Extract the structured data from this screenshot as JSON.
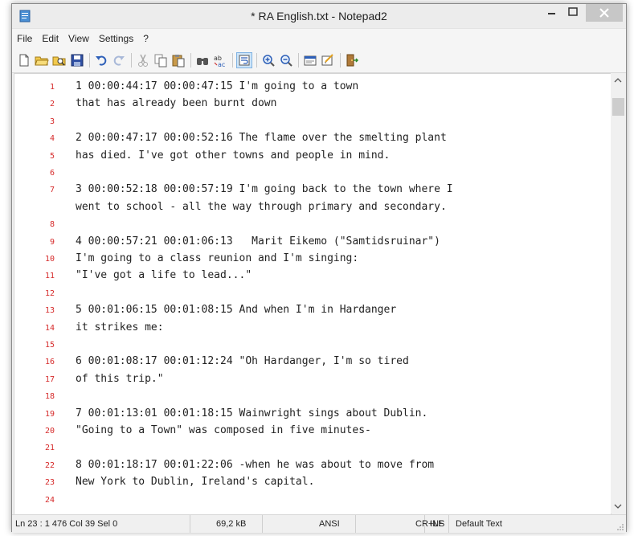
{
  "window": {
    "title": "* RA English.txt - Notepad2"
  },
  "menu": [
    "File",
    "Edit",
    "View",
    "Settings",
    "?"
  ],
  "toolbar": {
    "icons": [
      "new-file-icon",
      "open-folder-icon",
      "browse-icon",
      "save-icon",
      "undo-icon",
      "redo-icon",
      "cut-icon",
      "copy-icon",
      "paste-icon",
      "find-icon",
      "replace-icon",
      "word-wrap-icon",
      "zoom-in-icon",
      "zoom-out-icon",
      "scheme-icon",
      "customize-icon",
      "exit-icon"
    ]
  },
  "editor": {
    "lines": [
      {
        "n": "1",
        "text": "1 00:00:44:17 00:00:47:15 I'm going to a town"
      },
      {
        "n": "2",
        "text": "that has already been burnt down"
      },
      {
        "n": "3",
        "text": ""
      },
      {
        "n": "4",
        "text": "2 00:00:47:17 00:00:52:16 The flame over the smelting plant"
      },
      {
        "n": "5",
        "text": "has died. I've got other towns and people in mind."
      },
      {
        "n": "6",
        "text": ""
      },
      {
        "n": "7",
        "text": "3 00:00:52:18 00:00:57:19 I'm going back to the town where I"
      },
      {
        "n": "",
        "text": "went to school - all the way through primary and secondary."
      },
      {
        "n": "8",
        "text": ""
      },
      {
        "n": "9",
        "text": "4 00:00:57:21 00:01:06:13   Marit Eikemo (\"Samtidsruinar\")"
      },
      {
        "n": "10",
        "text": "I'm going to a class reunion and I'm singing:"
      },
      {
        "n": "11",
        "text": "\"I've got a life to lead...\""
      },
      {
        "n": "12",
        "text": ""
      },
      {
        "n": "13",
        "text": "5 00:01:06:15 00:01:08:15 And when I'm in Hardanger"
      },
      {
        "n": "14",
        "text": "it strikes me:"
      },
      {
        "n": "15",
        "text": ""
      },
      {
        "n": "16",
        "text": "6 00:01:08:17 00:01:12:24 \"Oh Hardanger, I'm so tired"
      },
      {
        "n": "17",
        "text": "of this trip.\""
      },
      {
        "n": "18",
        "text": ""
      },
      {
        "n": "19",
        "text": "7 00:01:13:01 00:01:18:15 Wainwright sings about Dublin."
      },
      {
        "n": "20",
        "text": "\"Going to a Town\" was composed in five minutes-"
      },
      {
        "n": "21",
        "text": ""
      },
      {
        "n": "22",
        "text": "8 00:01:18:17 00:01:22:06 -when he was about to move from"
      },
      {
        "n": "23",
        "text": "New York to Dublin, Ireland's capital."
      },
      {
        "n": "24",
        "text": ""
      }
    ]
  },
  "status": {
    "position": "Ln 23 : 1 476  Col 39  Sel 0",
    "size": "69,2 kB",
    "encoding": "ANSI",
    "eol": "CR+LF",
    "mode": "INS",
    "scheme": "Default Text"
  },
  "colors": {
    "line_number": "#d62b2b",
    "active_tool": "#cde4f7"
  }
}
